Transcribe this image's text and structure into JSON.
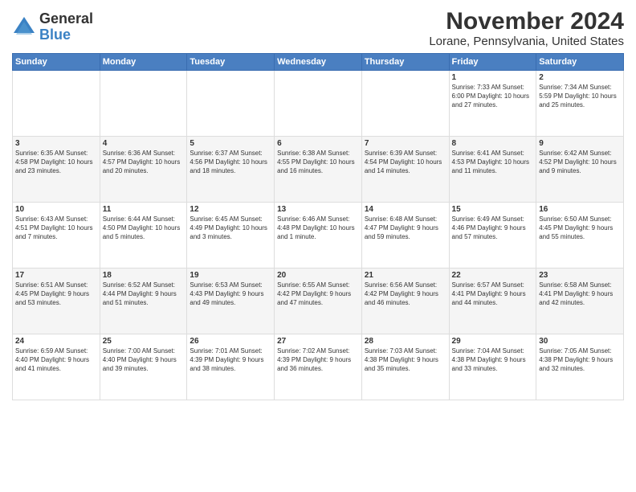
{
  "logo": {
    "general": "General",
    "blue": "Blue"
  },
  "title": "November 2024",
  "subtitle": "Lorane, Pennsylvania, United States",
  "headers": [
    "Sunday",
    "Monday",
    "Tuesday",
    "Wednesday",
    "Thursday",
    "Friday",
    "Saturday"
  ],
  "weeks": [
    [
      {
        "day": "",
        "content": ""
      },
      {
        "day": "",
        "content": ""
      },
      {
        "day": "",
        "content": ""
      },
      {
        "day": "",
        "content": ""
      },
      {
        "day": "",
        "content": ""
      },
      {
        "day": "1",
        "content": "Sunrise: 7:33 AM\nSunset: 6:00 PM\nDaylight: 10 hours and 27 minutes."
      },
      {
        "day": "2",
        "content": "Sunrise: 7:34 AM\nSunset: 5:59 PM\nDaylight: 10 hours and 25 minutes."
      }
    ],
    [
      {
        "day": "3",
        "content": "Sunrise: 6:35 AM\nSunset: 4:58 PM\nDaylight: 10 hours and 23 minutes."
      },
      {
        "day": "4",
        "content": "Sunrise: 6:36 AM\nSunset: 4:57 PM\nDaylight: 10 hours and 20 minutes."
      },
      {
        "day": "5",
        "content": "Sunrise: 6:37 AM\nSunset: 4:56 PM\nDaylight: 10 hours and 18 minutes."
      },
      {
        "day": "6",
        "content": "Sunrise: 6:38 AM\nSunset: 4:55 PM\nDaylight: 10 hours and 16 minutes."
      },
      {
        "day": "7",
        "content": "Sunrise: 6:39 AM\nSunset: 4:54 PM\nDaylight: 10 hours and 14 minutes."
      },
      {
        "day": "8",
        "content": "Sunrise: 6:41 AM\nSunset: 4:53 PM\nDaylight: 10 hours and 11 minutes."
      },
      {
        "day": "9",
        "content": "Sunrise: 6:42 AM\nSunset: 4:52 PM\nDaylight: 10 hours and 9 minutes."
      }
    ],
    [
      {
        "day": "10",
        "content": "Sunrise: 6:43 AM\nSunset: 4:51 PM\nDaylight: 10 hours and 7 minutes."
      },
      {
        "day": "11",
        "content": "Sunrise: 6:44 AM\nSunset: 4:50 PM\nDaylight: 10 hours and 5 minutes."
      },
      {
        "day": "12",
        "content": "Sunrise: 6:45 AM\nSunset: 4:49 PM\nDaylight: 10 hours and 3 minutes."
      },
      {
        "day": "13",
        "content": "Sunrise: 6:46 AM\nSunset: 4:48 PM\nDaylight: 10 hours and 1 minute."
      },
      {
        "day": "14",
        "content": "Sunrise: 6:48 AM\nSunset: 4:47 PM\nDaylight: 9 hours and 59 minutes."
      },
      {
        "day": "15",
        "content": "Sunrise: 6:49 AM\nSunset: 4:46 PM\nDaylight: 9 hours and 57 minutes."
      },
      {
        "day": "16",
        "content": "Sunrise: 6:50 AM\nSunset: 4:45 PM\nDaylight: 9 hours and 55 minutes."
      }
    ],
    [
      {
        "day": "17",
        "content": "Sunrise: 6:51 AM\nSunset: 4:45 PM\nDaylight: 9 hours and 53 minutes."
      },
      {
        "day": "18",
        "content": "Sunrise: 6:52 AM\nSunset: 4:44 PM\nDaylight: 9 hours and 51 minutes."
      },
      {
        "day": "19",
        "content": "Sunrise: 6:53 AM\nSunset: 4:43 PM\nDaylight: 9 hours and 49 minutes."
      },
      {
        "day": "20",
        "content": "Sunrise: 6:55 AM\nSunset: 4:42 PM\nDaylight: 9 hours and 47 minutes."
      },
      {
        "day": "21",
        "content": "Sunrise: 6:56 AM\nSunset: 4:42 PM\nDaylight: 9 hours and 46 minutes."
      },
      {
        "day": "22",
        "content": "Sunrise: 6:57 AM\nSunset: 4:41 PM\nDaylight: 9 hours and 44 minutes."
      },
      {
        "day": "23",
        "content": "Sunrise: 6:58 AM\nSunset: 4:41 PM\nDaylight: 9 hours and 42 minutes."
      }
    ],
    [
      {
        "day": "24",
        "content": "Sunrise: 6:59 AM\nSunset: 4:40 PM\nDaylight: 9 hours and 41 minutes."
      },
      {
        "day": "25",
        "content": "Sunrise: 7:00 AM\nSunset: 4:40 PM\nDaylight: 9 hours and 39 minutes."
      },
      {
        "day": "26",
        "content": "Sunrise: 7:01 AM\nSunset: 4:39 PM\nDaylight: 9 hours and 38 minutes."
      },
      {
        "day": "27",
        "content": "Sunrise: 7:02 AM\nSunset: 4:39 PM\nDaylight: 9 hours and 36 minutes."
      },
      {
        "day": "28",
        "content": "Sunrise: 7:03 AM\nSunset: 4:38 PM\nDaylight: 9 hours and 35 minutes."
      },
      {
        "day": "29",
        "content": "Sunrise: 7:04 AM\nSunset: 4:38 PM\nDaylight: 9 hours and 33 minutes."
      },
      {
        "day": "30",
        "content": "Sunrise: 7:05 AM\nSunset: 4:38 PM\nDaylight: 9 hours and 32 minutes."
      }
    ]
  ]
}
